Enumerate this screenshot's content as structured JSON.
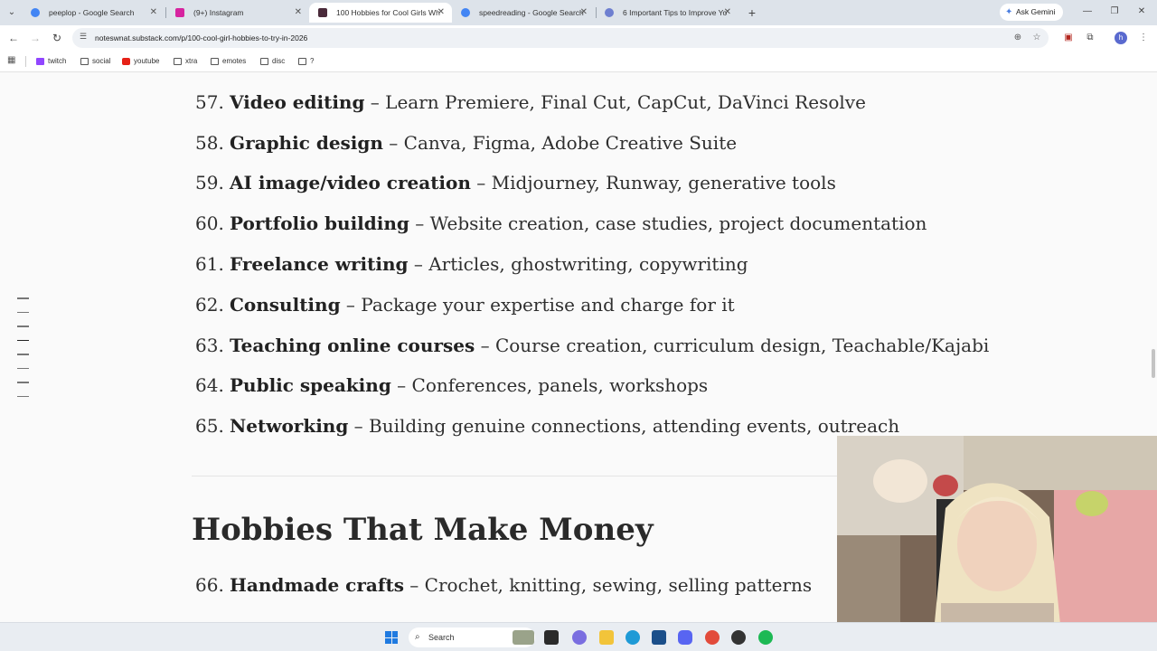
{
  "tabs": [
    {
      "title": "peeplop - Google Search",
      "active": false
    },
    {
      "title": "(9+) Instagram",
      "active": false
    },
    {
      "title": "100 Hobbies for Cool Girls Wh",
      "active": true
    },
    {
      "title": "speedreading - Google Search",
      "active": false
    },
    {
      "title": "6 Important Tips to Improve Yo",
      "active": false
    }
  ],
  "ask_gemini": "Ask Gemini",
  "address_bar": {
    "url": "noteswnat.substack.com/p/100-cool-girl-hobbies-to-try-in-2026"
  },
  "bookmarks": [
    "twitch",
    "social",
    "youtube",
    "xtra",
    "emotes",
    "disc",
    "?"
  ],
  "article": {
    "items": [
      {
        "num": "57.",
        "title": "Video editing",
        "desc": " – Learn Premiere, Final Cut, CapCut, DaVinci Resolve"
      },
      {
        "num": "58.",
        "title": "Graphic design",
        "desc": " – Canva, Figma, Adobe Creative Suite"
      },
      {
        "num": "59.",
        "title": "AI image/video creation",
        "desc": " – Midjourney, Runway, generative tools"
      },
      {
        "num": "60.",
        "title": "Portfolio building",
        "desc": " – Website creation, case studies, project documentation"
      },
      {
        "num": "61.",
        "title": "Freelance writing",
        "desc": " – Articles, ghostwriting, copywriting"
      },
      {
        "num": "62.",
        "title": "Consulting",
        "desc": " – Package your expertise and charge for it"
      },
      {
        "num": "63.",
        "title": "Teaching online courses",
        "desc": " – Course creation, curriculum design, Teachable/Kajabi"
      },
      {
        "num": "64.",
        "title": "Public speaking",
        "desc": " – Conferences, panels, workshops"
      },
      {
        "num": "65.",
        "title": "Networking",
        "desc": " – Building genuine connections, attending events, outreach"
      }
    ],
    "section_heading": "Hobbies That Make Money",
    "section_items": [
      {
        "num": "66.",
        "title": "Handmade crafts",
        "desc": " – Crochet, knitting, sewing, selling patterns"
      }
    ]
  },
  "taskbar": {
    "search_placeholder": "Search"
  },
  "colors": {
    "tab_strip": "#dde3ea",
    "page_bg": "#fafafa",
    "text": "#2f2f2f",
    "accent_blue": "#1f7ae0"
  }
}
